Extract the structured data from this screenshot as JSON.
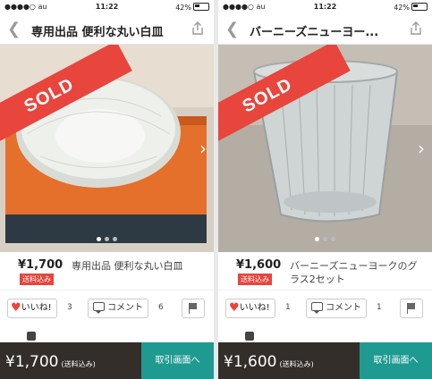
{
  "screens": [
    {
      "status": {
        "carrier": "●●●●○ au",
        "time": "11:22",
        "battery": "42%"
      },
      "nav": {
        "title": "専用出品 便利な丸い白皿"
      },
      "sold_label": "SOLD",
      "price": "¥1,700",
      "shipping_badge": "送料込み",
      "item_name": "専用出品 便利な丸い白皿",
      "like_label": "いいね!",
      "like_count": "3",
      "comment_label": "コメント",
      "comment_count": "6",
      "bottom_price": "¥1,700",
      "bottom_price_note": "(送料込み)",
      "trade_button": "取引画面へ",
      "carousel": {
        "pages": 3,
        "current": 1
      }
    },
    {
      "status": {
        "carrier": "●●●●○ au",
        "time": "11:22",
        "battery": "42%"
      },
      "nav": {
        "title": "バーニーズニューヨー..."
      },
      "sold_label": "SOLD",
      "price": "¥1,600",
      "shipping_badge": "送料込み",
      "item_name": "バーニーズニューヨークのグラス2セット",
      "like_label": "いいね!",
      "like_count": "1",
      "comment_label": "コメント",
      "comment_count": "1",
      "bottom_price": "¥1,600",
      "bottom_price_note": "(送料込み)",
      "trade_button": "取引画面へ",
      "carousel": {
        "pages": 3,
        "current": 1
      }
    }
  ],
  "colors": {
    "accent": "#e8453c",
    "trade": "#1f9a91",
    "bottombar": "#332e2a"
  }
}
